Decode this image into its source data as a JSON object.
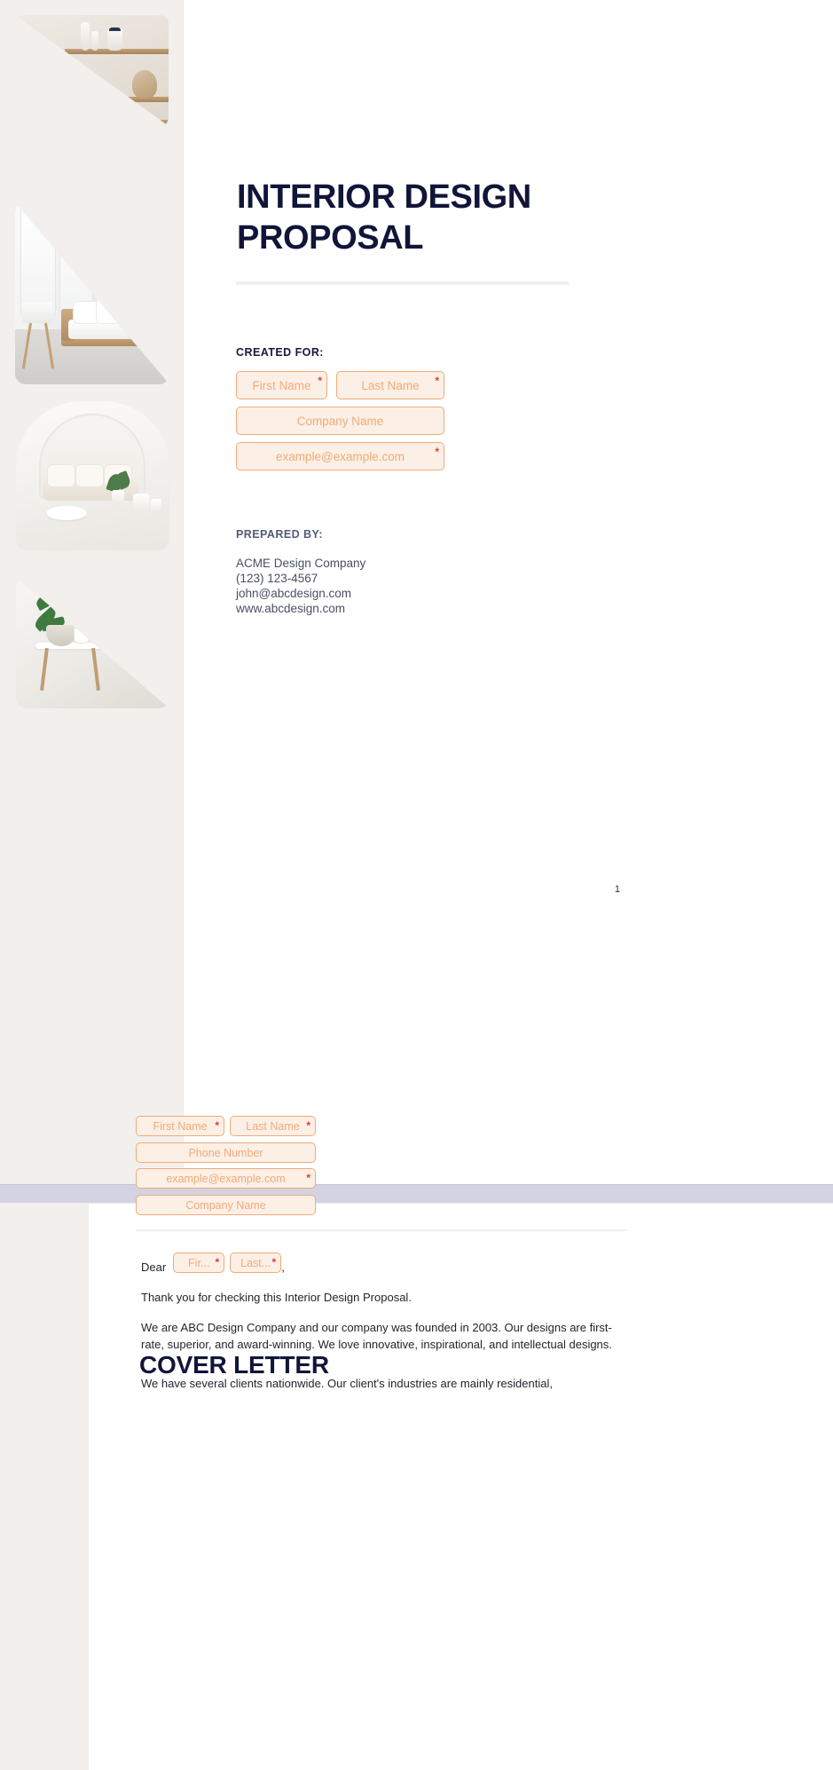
{
  "document": {
    "page1": {
      "title": "INTERIOR DESIGN PROPOSAL",
      "created_for_label": "CREATED FOR:",
      "prepared_by_label": "PREPARED BY:",
      "fields": {
        "first_name": {
          "placeholder": "First Name",
          "required": "*"
        },
        "last_name": {
          "placeholder": "Last Name",
          "required": "*"
        },
        "company_name": {
          "placeholder": "Company Name",
          "required": ""
        },
        "email": {
          "placeholder": "example@example.com",
          "required": "*"
        }
      },
      "prepared_by": {
        "company": "ACME Design Company",
        "phone": "(123) 123-4567",
        "email": "john@abcdesign.com",
        "website": "www.abcdesign.com"
      },
      "page_number": "1"
    },
    "page2": {
      "title": "COVER LETTER",
      "fields": {
        "first_name": {
          "placeholder": "First Name",
          "required": "*"
        },
        "last_name": {
          "placeholder": "Last Name",
          "required": "*"
        },
        "phone_number": {
          "placeholder": "Phone Number",
          "required": ""
        },
        "email": {
          "placeholder": "example@example.com",
          "required": "*"
        },
        "company_name": {
          "placeholder": "Company Name",
          "required": ""
        }
      },
      "salutation": {
        "word": "Dear",
        "first_name": {
          "placeholder": "Fir...",
          "required": "*"
        },
        "last_name": {
          "placeholder": "Last...",
          "required": "*"
        },
        "comma": ","
      },
      "paragraphs": [
        "Thank you for checking this Interior Design Proposal.",
        "We are ABC Design Company and our company was founded in 2003. Our designs are first-rate, superior, and award-winning. We love innovative, inspirational, and intellectual designs.",
        "We have several clients nationwide. Our client's industries are mainly residential,"
      ]
    }
  },
  "colors": {
    "heading_navy": "#111539",
    "field_border": "#f0ab78",
    "field_fill": "#fcefe5",
    "field_text": "#f0ab78",
    "required_red": "#e03a2f",
    "rail_beige": "#f2efed",
    "page_gap": "#d3d3e2",
    "body_text": "#24252c"
  }
}
